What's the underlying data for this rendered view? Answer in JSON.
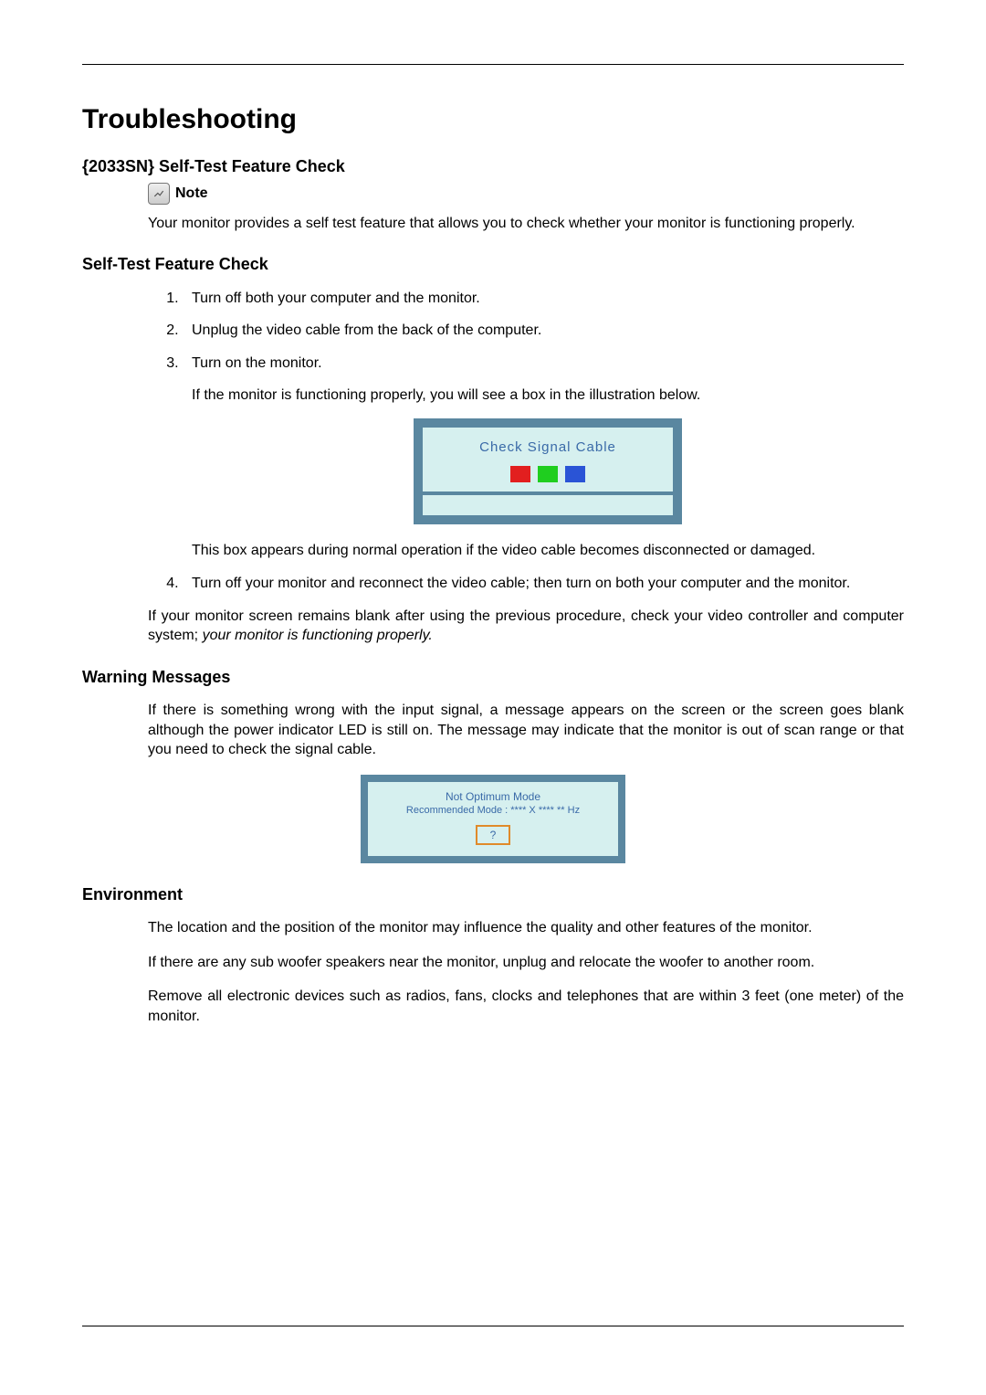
{
  "title": "Troubleshooting",
  "sec1": {
    "heading": "{2033SN} Self-Test Feature Check",
    "note_label": "Note",
    "note_text": "Your monitor provides a self test feature that allows you to check whether your monitor is functioning properly."
  },
  "sec2": {
    "heading": "Self-Test Feature Check",
    "steps": {
      "s1": "Turn off both your computer and the monitor.",
      "s2": "Unplug the video cable from the back of the computer.",
      "s3a": "Turn on the monitor.",
      "s3b": "If the monitor is functioning properly, you will see a box in the illustration below.",
      "s3c": "This box appears during normal operation if the video cable becomes disconnected or damaged.",
      "s4": "Turn off your monitor and reconnect the video cable; then turn on both your computer and the monitor."
    },
    "osd1_title": "Check Signal Cable",
    "after_a": "If your monitor screen remains blank after using the previous procedure, check your video controller and computer system; ",
    "after_b": "your monitor is functioning properly."
  },
  "sec3": {
    "heading": "Warning Messages",
    "p": "If there is something wrong with the input signal, a message appears on the screen or the screen goes blank although the power indicator LED is still on. The message may indicate that the monitor is out of scan range or that you need to check the signal cable.",
    "osd2_l1": "Not Optimum Mode",
    "osd2_l2": "Recommended Mode : **** X **** ** Hz",
    "osd2_btn": "?"
  },
  "sec4": {
    "heading": "Environment",
    "p1": "The location and the position of the monitor may influence the quality and other features of the monitor.",
    "p2": "If there are any sub woofer speakers near the monitor, unplug and relocate the woofer to another room.",
    "p3": "Remove all electronic devices such as radios, fans, clocks and telephones that are within 3 feet (one meter) of the monitor."
  }
}
